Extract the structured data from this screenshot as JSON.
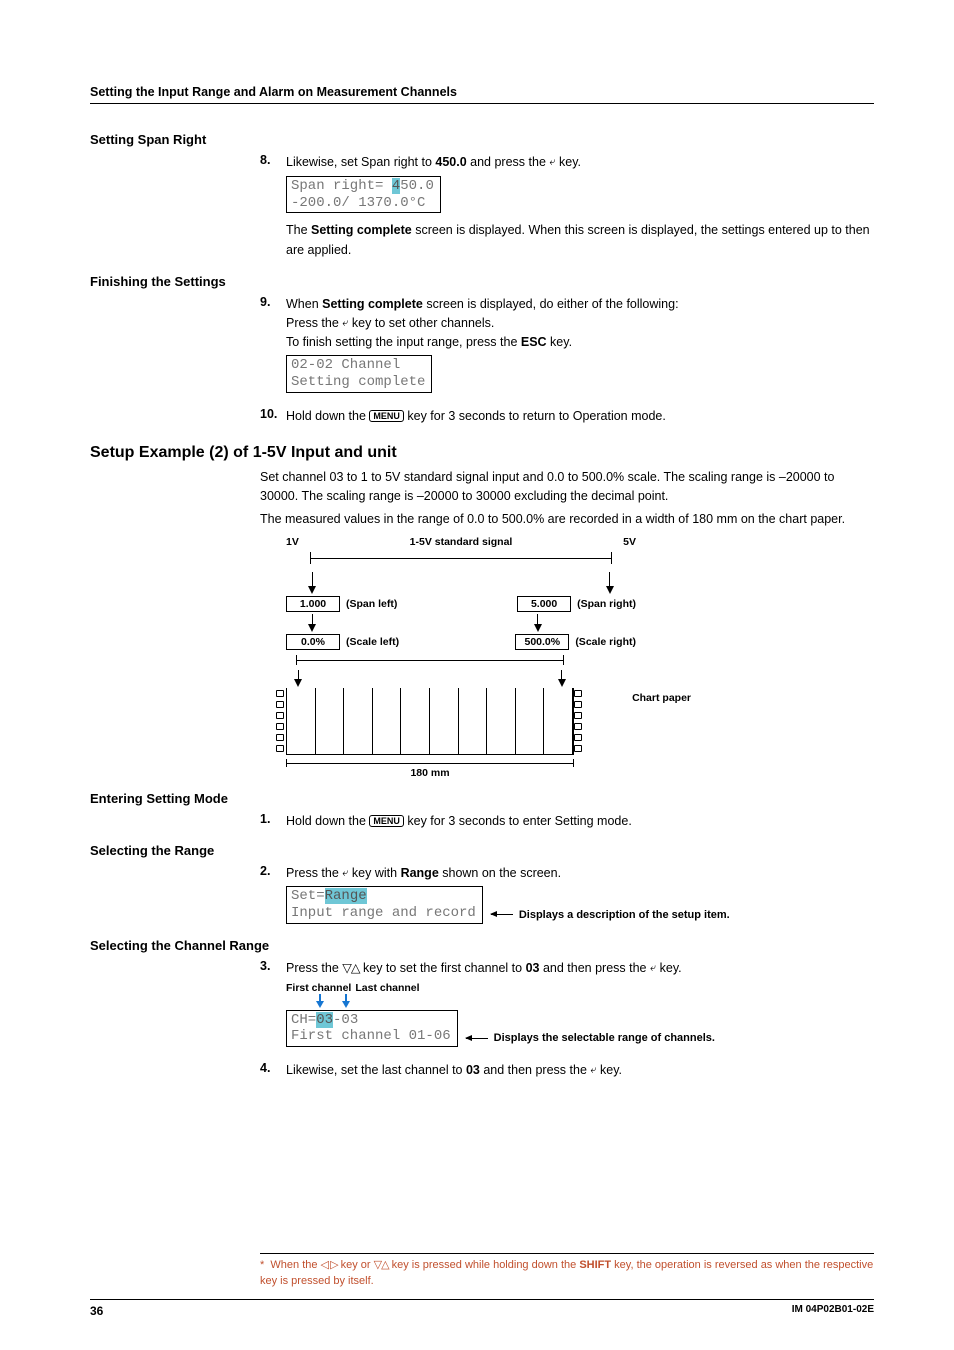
{
  "header": "Setting the Input Range and Alarm on Measurement Channels",
  "s1": {
    "title": "Setting Span Right",
    "step8_num": "8.",
    "step8_a": "Likewise, set Span right to ",
    "step8_b": "450.0",
    "step8_c": " and press the ",
    "step8_d": " key.",
    "lcd_l1a": "Span right= ",
    "lcd_l1b": "4",
    "lcd_l1c": "50.0",
    "lcd_l2": "-200.0/ 1370.0°C",
    "para_a": "The ",
    "para_b": "Setting complete",
    "para_c": " screen is displayed. When this screen is displayed, the settings entered up to then are applied."
  },
  "s2": {
    "title": "Finishing the Settings",
    "step9_num": "9.",
    "step9_a": "When ",
    "step9_b": "Setting complete",
    "step9_c": " screen is displayed, do either of the following:",
    "step9_d": "Press the ",
    "step9_e": " key to set other channels.",
    "step9_f": "To finish setting the input range, press the ",
    "step9_g": "ESC",
    "step9_h": " key.",
    "lcd_l1": "02-02 Channel",
    "lcd_l2": "Setting complete",
    "step10_num": "10.",
    "step10_a": "Hold down the ",
    "step10_b": " key for 3 seconds to return to Operation mode."
  },
  "s3": {
    "title": "Setup Example (2) of 1-5V Input and unit",
    "p1": "Set channel 03 to 1 to 5V standard signal input and 0.0 to 500.0% scale. The scaling range is –20000 to 30000. The scaling range is –20000 to 30000 excluding the decimal point.",
    "p2": "The measured values in the range of 0.0 to 500.0% are recorded in a width of 180 mm on the chart paper."
  },
  "diag": {
    "sig": "1-5V standard signal",
    "v1": "1V",
    "v5": "5V",
    "span_l_v": "1.000",
    "span_l_t": "(Span left)",
    "span_r_v": "5.000",
    "span_r_t": "(Span right)",
    "scale_l_v": "0.0%",
    "scale_l_t": "(Scale left)",
    "scale_r_v": "500.0%",
    "scale_r_t": "(Scale right)",
    "chart": "Chart paper",
    "width": "180 mm"
  },
  "s4": {
    "title": "Entering Setting Mode",
    "step1_num": "1.",
    "step1_a": "Hold down the ",
    "step1_b": " key for 3 seconds to enter Setting mode."
  },
  "s5": {
    "title": "Selecting the Range",
    "step2_num": "2.",
    "step2_a": "Press the ",
    "step2_b": " key with ",
    "step2_c": "Range",
    "step2_d": " shown on the screen.",
    "lcd_l1a": "Set=",
    "lcd_l1b": "Range",
    "lcd_l2": "Input range and record",
    "callout": "Displays a description of the setup item."
  },
  "s6": {
    "title": "Selecting the Channel Range",
    "step3_num": "3.",
    "step3_a": "Press the ",
    "step3_b": " key to set the first channel to ",
    "step3_c": "03",
    "step3_d": " and then press the ",
    "step3_e": " key.",
    "legend_fc": "First channel",
    "legend_lc": "Last channel",
    "lcd_l1a": "CH=",
    "lcd_l1b": "03",
    "lcd_l1c": "-03",
    "lcd_l2": "First channel 01-06",
    "callout": "Displays the selectable range of channels.",
    "step4_num": "4.",
    "step4_a": "Likewise, set the last channel to ",
    "step4_b": "03",
    "step4_c": " and then press the ",
    "step4_d": " key."
  },
  "footnote": {
    "star": "*",
    "a": "When the ",
    "b": " key or ",
    "c": " key is pressed while holding down the ",
    "d": "SHIFT",
    "e": " key, the operation is reversed as when the respective key is pressed by itself."
  },
  "menu_key": "MENU",
  "footer": {
    "page": "36",
    "doc": "IM 04P02B01-02E"
  }
}
